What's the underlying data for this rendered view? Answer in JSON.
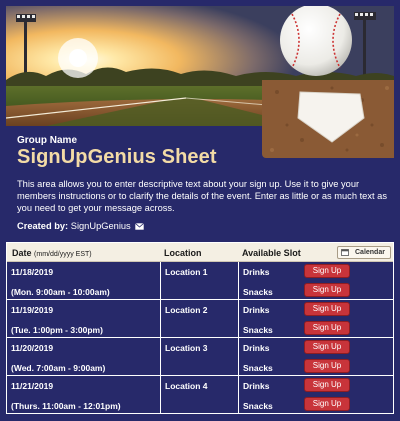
{
  "header": {
    "group_label": "Group Name",
    "title": "SignUpGenius Sheet",
    "description": "This area allows you to enter descriptive text about your sign up. Use it to give your members instructions or to clarify the details of the event. Enter as little or as much text as you need to get your message across.",
    "created_by_label": "Created by:",
    "created_by_name": "SignUpGenius"
  },
  "table": {
    "columns": {
      "date": "Date",
      "date_format": "(mm/dd/yyyy EST)",
      "location": "Location",
      "slot": "Available Slot"
    },
    "calendar_button": "Calendar",
    "rows": [
      {
        "date": "11/18/2019",
        "time": "(Mon. 9:00am - 10:00am)",
        "location": "Location 1",
        "slots": [
          {
            "name": "Drinks",
            "button": "Sign Up"
          },
          {
            "name": "Snacks",
            "button": "Sign Up"
          }
        ]
      },
      {
        "date": "11/19/2019",
        "time": "(Tue. 1:00pm - 3:00pm)",
        "location": "Location 2",
        "slots": [
          {
            "name": "Drinks",
            "button": "Sign Up"
          },
          {
            "name": "Snacks",
            "button": "Sign Up"
          }
        ]
      },
      {
        "date": "11/20/2019",
        "time": "(Wed. 7:00am - 9:00am)",
        "location": "Location 3",
        "slots": [
          {
            "name": "Drinks",
            "button": "Sign Up"
          },
          {
            "name": "Snacks",
            "button": "Sign Up"
          }
        ]
      },
      {
        "date": "11/21/2019",
        "time": "(Thurs. 11:00am - 12:01pm)",
        "location": "Location 4",
        "slots": [
          {
            "name": "Drinks",
            "button": "Sign Up"
          },
          {
            "name": "Snacks",
            "button": "Sign Up"
          }
        ]
      }
    ]
  },
  "colors": {
    "page_background": "#27296a",
    "title_color": "#f3dba6",
    "button_red": "#c8343a",
    "header_row": "#f4efe3"
  },
  "icons": {
    "mail": "envelope-icon",
    "calendar": "calendar-icon"
  }
}
